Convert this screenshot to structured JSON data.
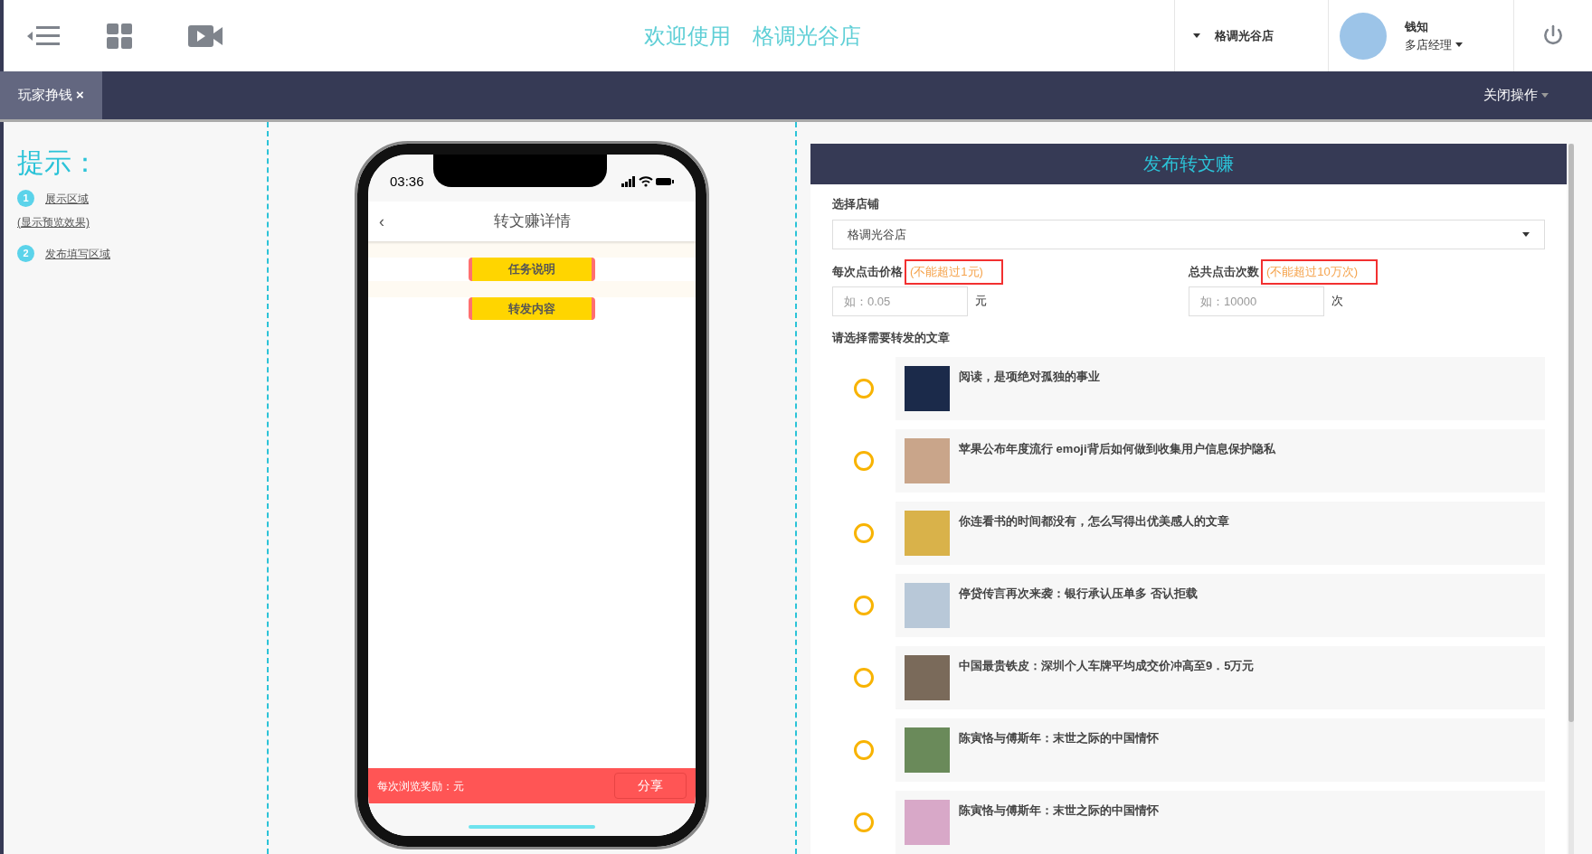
{
  "header": {
    "welcome": "欢迎使用",
    "store_name": "格调光谷店",
    "store_switch": "格调光谷店",
    "user": {
      "name": "钱知",
      "role": "多店经理"
    }
  },
  "tabs": [
    {
      "label": "玩家挣钱",
      "close": "×",
      "selected": true
    }
  ],
  "close_ops": "关闭操作",
  "tips": {
    "title": "提示：",
    "items": [
      {
        "num": "1",
        "label": "展示区域",
        "sub": "(显示预览效果)"
      },
      {
        "num": "2",
        "label": "发布填写区域"
      }
    ]
  },
  "phone": {
    "time": "03:36",
    "back": "‹",
    "title": "转文赚详情",
    "ribbons": [
      "任务说明",
      "转发内容"
    ],
    "reward": "每次浏览奖励：元",
    "share": "分享"
  },
  "form": {
    "title": "发布转文赚",
    "store_label": "选择店铺",
    "store_value": "格调光谷店",
    "price_label": "每次点击价格",
    "price_hint": "(不能超过1元)",
    "price_placeholder": "如：0.05",
    "price_unit": "元",
    "count_label": "总共点击次数",
    "count_hint": "(不能超过10万次)",
    "count_placeholder": "如：10000",
    "count_unit": "次",
    "articles_label": "请选择需要转发的文章",
    "articles": [
      {
        "title": "阅读，是项绝对孤独的事业",
        "selected": false
      },
      {
        "title": "苹果公布年度流行 emoji背后如何做到收集用户信息保护隐私",
        "selected": false
      },
      {
        "title": "你连看书的时间都没有，怎么写得出优美感人的文章",
        "selected": false
      },
      {
        "title": "停贷传言再次来袭：银行承认压单多 否认拒载",
        "selected": false
      },
      {
        "title": "中国最贵铁皮：深圳个人车牌平均成交价冲高至9．5万元",
        "selected": false
      },
      {
        "title": "陈寅恪与傅斯年：末世之际的中国情怀",
        "selected": false
      },
      {
        "title": "陈寅恪与傅斯年：末世之际的中国情怀",
        "selected": false
      }
    ]
  }
}
